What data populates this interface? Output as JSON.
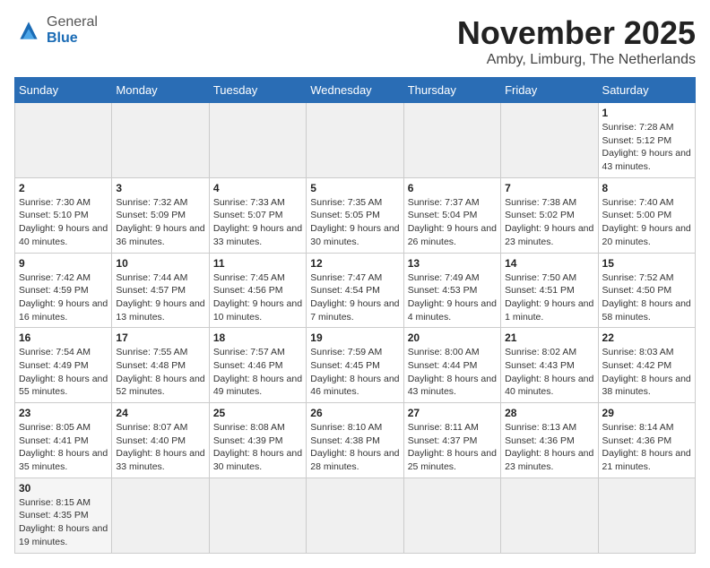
{
  "header": {
    "logo_general": "General",
    "logo_blue": "Blue",
    "title": "November 2025",
    "location": "Amby, Limburg, The Netherlands"
  },
  "weekdays": [
    "Sunday",
    "Monday",
    "Tuesday",
    "Wednesday",
    "Thursday",
    "Friday",
    "Saturday"
  ],
  "weeks": [
    [
      {
        "day": "",
        "info": "",
        "empty": true
      },
      {
        "day": "",
        "info": "",
        "empty": true
      },
      {
        "day": "",
        "info": "",
        "empty": true
      },
      {
        "day": "",
        "info": "",
        "empty": true
      },
      {
        "day": "",
        "info": "",
        "empty": true
      },
      {
        "day": "",
        "info": "",
        "empty": true
      },
      {
        "day": "1",
        "info": "Sunrise: 7:28 AM\nSunset: 5:12 PM\nDaylight: 9 hours and 43 minutes.",
        "empty": false
      }
    ],
    [
      {
        "day": "2",
        "info": "Sunrise: 7:30 AM\nSunset: 5:10 PM\nDaylight: 9 hours and 40 minutes.",
        "empty": false
      },
      {
        "day": "3",
        "info": "Sunrise: 7:32 AM\nSunset: 5:09 PM\nDaylight: 9 hours and 36 minutes.",
        "empty": false
      },
      {
        "day": "4",
        "info": "Sunrise: 7:33 AM\nSunset: 5:07 PM\nDaylight: 9 hours and 33 minutes.",
        "empty": false
      },
      {
        "day": "5",
        "info": "Sunrise: 7:35 AM\nSunset: 5:05 PM\nDaylight: 9 hours and 30 minutes.",
        "empty": false
      },
      {
        "day": "6",
        "info": "Sunrise: 7:37 AM\nSunset: 5:04 PM\nDaylight: 9 hours and 26 minutes.",
        "empty": false
      },
      {
        "day": "7",
        "info": "Sunrise: 7:38 AM\nSunset: 5:02 PM\nDaylight: 9 hours and 23 minutes.",
        "empty": false
      },
      {
        "day": "8",
        "info": "Sunrise: 7:40 AM\nSunset: 5:00 PM\nDaylight: 9 hours and 20 minutes.",
        "empty": false
      }
    ],
    [
      {
        "day": "9",
        "info": "Sunrise: 7:42 AM\nSunset: 4:59 PM\nDaylight: 9 hours and 16 minutes.",
        "empty": false
      },
      {
        "day": "10",
        "info": "Sunrise: 7:44 AM\nSunset: 4:57 PM\nDaylight: 9 hours and 13 minutes.",
        "empty": false
      },
      {
        "day": "11",
        "info": "Sunrise: 7:45 AM\nSunset: 4:56 PM\nDaylight: 9 hours and 10 minutes.",
        "empty": false
      },
      {
        "day": "12",
        "info": "Sunrise: 7:47 AM\nSunset: 4:54 PM\nDaylight: 9 hours and 7 minutes.",
        "empty": false
      },
      {
        "day": "13",
        "info": "Sunrise: 7:49 AM\nSunset: 4:53 PM\nDaylight: 9 hours and 4 minutes.",
        "empty": false
      },
      {
        "day": "14",
        "info": "Sunrise: 7:50 AM\nSunset: 4:51 PM\nDaylight: 9 hours and 1 minute.",
        "empty": false
      },
      {
        "day": "15",
        "info": "Sunrise: 7:52 AM\nSunset: 4:50 PM\nDaylight: 8 hours and 58 minutes.",
        "empty": false
      }
    ],
    [
      {
        "day": "16",
        "info": "Sunrise: 7:54 AM\nSunset: 4:49 PM\nDaylight: 8 hours and 55 minutes.",
        "empty": false
      },
      {
        "day": "17",
        "info": "Sunrise: 7:55 AM\nSunset: 4:48 PM\nDaylight: 8 hours and 52 minutes.",
        "empty": false
      },
      {
        "day": "18",
        "info": "Sunrise: 7:57 AM\nSunset: 4:46 PM\nDaylight: 8 hours and 49 minutes.",
        "empty": false
      },
      {
        "day": "19",
        "info": "Sunrise: 7:59 AM\nSunset: 4:45 PM\nDaylight: 8 hours and 46 minutes.",
        "empty": false
      },
      {
        "day": "20",
        "info": "Sunrise: 8:00 AM\nSunset: 4:44 PM\nDaylight: 8 hours and 43 minutes.",
        "empty": false
      },
      {
        "day": "21",
        "info": "Sunrise: 8:02 AM\nSunset: 4:43 PM\nDaylight: 8 hours and 40 minutes.",
        "empty": false
      },
      {
        "day": "22",
        "info": "Sunrise: 8:03 AM\nSunset: 4:42 PM\nDaylight: 8 hours and 38 minutes.",
        "empty": false
      }
    ],
    [
      {
        "day": "23",
        "info": "Sunrise: 8:05 AM\nSunset: 4:41 PM\nDaylight: 8 hours and 35 minutes.",
        "empty": false
      },
      {
        "day": "24",
        "info": "Sunrise: 8:07 AM\nSunset: 4:40 PM\nDaylight: 8 hours and 33 minutes.",
        "empty": false
      },
      {
        "day": "25",
        "info": "Sunrise: 8:08 AM\nSunset: 4:39 PM\nDaylight: 8 hours and 30 minutes.",
        "empty": false
      },
      {
        "day": "26",
        "info": "Sunrise: 8:10 AM\nSunset: 4:38 PM\nDaylight: 8 hours and 28 minutes.",
        "empty": false
      },
      {
        "day": "27",
        "info": "Sunrise: 8:11 AM\nSunset: 4:37 PM\nDaylight: 8 hours and 25 minutes.",
        "empty": false
      },
      {
        "day": "28",
        "info": "Sunrise: 8:13 AM\nSunset: 4:36 PM\nDaylight: 8 hours and 23 minutes.",
        "empty": false
      },
      {
        "day": "29",
        "info": "Sunrise: 8:14 AM\nSunset: 4:36 PM\nDaylight: 8 hours and 21 minutes.",
        "empty": false
      }
    ],
    [
      {
        "day": "30",
        "info": "Sunrise: 8:15 AM\nSunset: 4:35 PM\nDaylight: 8 hours and 19 minutes.",
        "empty": false
      },
      {
        "day": "",
        "info": "",
        "empty": true
      },
      {
        "day": "",
        "info": "",
        "empty": true
      },
      {
        "day": "",
        "info": "",
        "empty": true
      },
      {
        "day": "",
        "info": "",
        "empty": true
      },
      {
        "day": "",
        "info": "",
        "empty": true
      },
      {
        "day": "",
        "info": "",
        "empty": true
      }
    ]
  ]
}
